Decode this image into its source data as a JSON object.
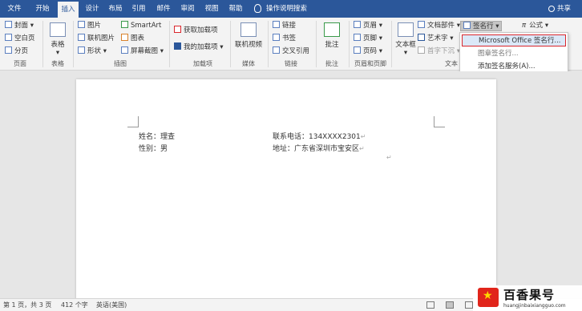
{
  "tabs": [
    "文件",
    "开始",
    "插入",
    "设计",
    "布局",
    "引用",
    "邮件",
    "审阅",
    "视图",
    "帮助"
  ],
  "tell_me": "操作说明搜索",
  "share": "共享",
  "ribbon": {
    "pages": {
      "cover": "封面",
      "blank": "空白页",
      "break": "分页",
      "group": "页面"
    },
    "table": {
      "label": "表格",
      "group": "表格"
    },
    "illustrations": {
      "picture": "图片",
      "online_picture": "联机图片",
      "shapes": "形状",
      "smartart": "SmartArt",
      "chart": "图表",
      "screenshot": "屏幕截图",
      "group": "插图"
    },
    "addins": {
      "get": "获取加载项",
      "my": "我的加载项",
      "group": "加载项"
    },
    "media": {
      "online_video": "联机视频",
      "group": "媒体"
    },
    "links": {
      "link": "链接",
      "bookmark": "书签",
      "cross_ref": "交叉引用",
      "group": "链接"
    },
    "comments": {
      "comment": "批注",
      "group": "批注"
    },
    "header_footer": {
      "header": "页眉",
      "footer": "页脚",
      "page_number": "页码",
      "group": "页眉和页脚"
    },
    "text": {
      "text_box": "文本框",
      "quick_parts": "文档部件",
      "wordart": "艺术字",
      "drop_cap": "首字下沉",
      "signature_line": "签名行",
      "group": "文本"
    },
    "symbols": {
      "equation": "公式"
    }
  },
  "signature_menu": {
    "items": [
      "Microsoft Office 签名行...",
      "图章签名行...",
      "添加签名服务(A)..."
    ]
  },
  "document": {
    "name_label": "姓名：理查",
    "gender_label": "性别：男",
    "phone_label": "联系电话：134XXXX2301",
    "address_label": "地址：广东省深圳市宝安区",
    "para_mark": "↵"
  },
  "status": {
    "page": "第 1 页，共 3 页",
    "words": "412 个字",
    "lang": "英语(美国)"
  },
  "watermark": {
    "title": "百香果号",
    "url": "huangjinbaixiangguo.com"
  }
}
